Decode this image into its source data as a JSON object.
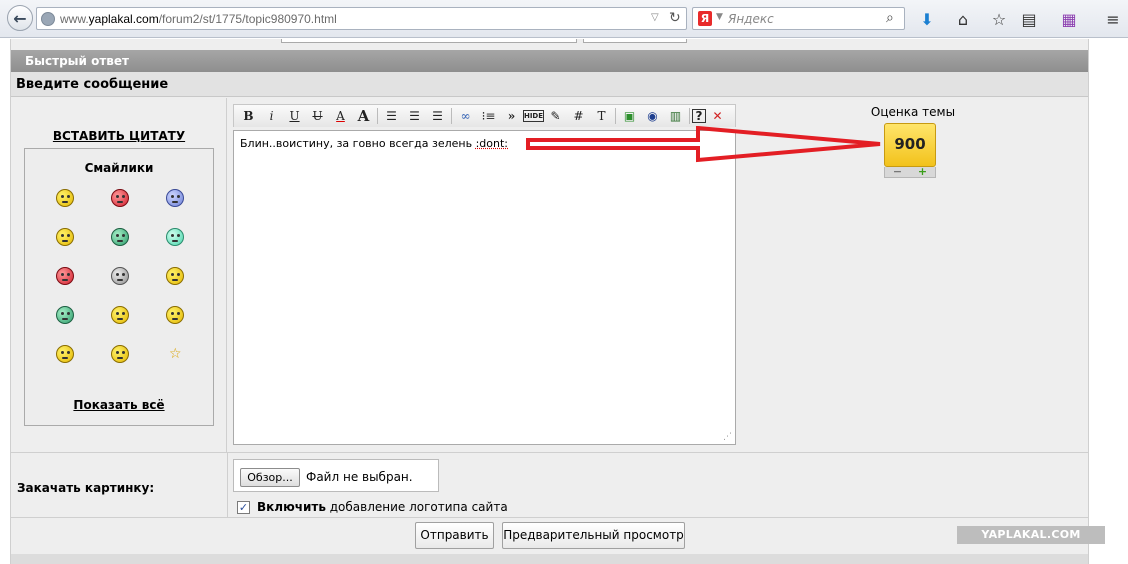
{
  "browser": {
    "url_prefix": "www.",
    "url_domain": "yaplakal.com",
    "url_path": "/forum2/st/1775/topic980970.html",
    "search_placeholder": "Яндекс",
    "yandex_letter": "Я"
  },
  "page": {
    "header_title": "Быстрый ответ",
    "sub_title": "Введите сообщение",
    "insert_quote": "ВСТАВИТЬ ЦИТАТУ",
    "smileys_title": "Смайлики",
    "show_all": "Показать всё",
    "smileys": [
      {
        "icon": "cool-smiley-icon",
        "color": "yellow"
      },
      {
        "icon": "love-smiley-icon",
        "color": "red"
      },
      {
        "icon": "crying-smiley-icon",
        "color": "blue"
      },
      {
        "icon": "thumbs-up-smiley-icon",
        "color": "yellow"
      },
      {
        "icon": "gun-smiley-icon",
        "color": "green"
      },
      {
        "icon": "round-smiley-icon",
        "color": "teal"
      },
      {
        "icon": "shooting-smiley-icon",
        "color": "red"
      },
      {
        "icon": "dancing-smiley-icon",
        "color": "gray"
      },
      {
        "icon": "cheering-smiley-icon",
        "color": "yellow"
      },
      {
        "icon": "dark-smiley-icon",
        "color": "green"
      },
      {
        "icon": "clapping-hands-icon",
        "color": "yellow"
      },
      {
        "icon": "girl-smiley-icon",
        "color": "yellow"
      },
      {
        "icon": "horns-smiley-icon",
        "color": "yellow"
      },
      {
        "icon": "laughing-smiley-icon",
        "color": "yellow"
      },
      {
        "icon": "star-icon",
        "color": "star"
      }
    ],
    "editor_text_before": "Блин..воистину, за говно всегда зелень ",
    "editor_text_code": ":dont:",
    "rating_label": "Оценка темы",
    "rating_value": "900",
    "rating_minus": "−",
    "rating_plus": "+",
    "upload_label": "Закачать картинку:",
    "browse_label": "Обзор...",
    "no_file_label": "Файл не выбран.",
    "logo_bold": "Включить",
    "logo_rest": " добавление логотипа сайта",
    "logo_checked": "✓",
    "send_label": "Отправить",
    "preview_label": "Предварительный просмотр",
    "watermark": "YAPLAKAL.COM"
  },
  "toolbar": {
    "bold": "B",
    "italic": "i",
    "underline": "U",
    "strike": "U",
    "font_color": "A",
    "font_size": "A",
    "hide": "HIDE",
    "hash": "#",
    "text": "T",
    "help": "?",
    "close": "✕",
    "quote": "»"
  },
  "colors": {
    "header_bar": "#9a9a9a",
    "arrow_red": "#e31e24",
    "rating_yellow": "#f6cf2a"
  }
}
